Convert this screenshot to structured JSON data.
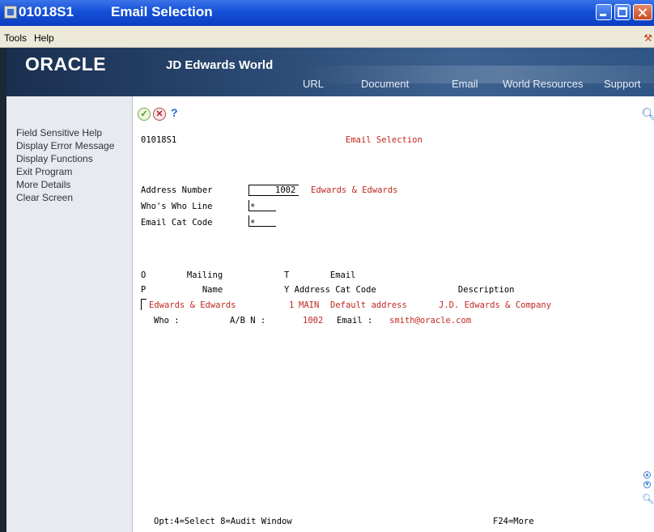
{
  "window": {
    "code": "01018S1",
    "title": "Email Selection"
  },
  "menu": {
    "items": [
      "Tools",
      "Help"
    ]
  },
  "banner": {
    "logo": "ORACLE",
    "product": "JD Edwards World",
    "links": [
      "URL",
      "Document",
      "Email",
      "World Resources",
      "Support"
    ]
  },
  "sidebar": {
    "items": [
      "Field Sensitive Help",
      "Display Error Message",
      "Display Functions",
      "Exit Program",
      "More Details",
      "Clear Screen"
    ]
  },
  "toolbar": {
    "help_symbol": "?"
  },
  "form": {
    "program_id": "01018S1",
    "heading": "Email Selection",
    "address_number_label": "Address Number",
    "address_number_value": "1002",
    "address_name": "Edwards & Edwards",
    "whos_who_label": "Who's Who Line",
    "whos_who_value": "*",
    "email_cat_label": "Email Cat Code",
    "email_cat_value": "*"
  },
  "grid": {
    "header_row1": "O        Mailing            T        Email",
    "header_row2": "P           Name            Y Address Cat Code                Description",
    "rows": [
      {
        "mailing_name": "Edwards & Edwards",
        "type": "1",
        "cat_code": "MAIN",
        "address_desc": "Default address",
        "description": "J.D. Edwards & Company",
        "who_label": "Who :",
        "ab_label": "A/B N :",
        "ab_value": "1002",
        "email_label": "Email :",
        "email_value": "smith@oracle.com"
      }
    ]
  },
  "footer": {
    "options": "Opt:4=Select 8=Audit Window",
    "more": "F24=More"
  }
}
